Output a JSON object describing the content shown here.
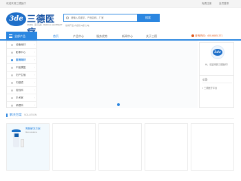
{
  "topbar": {
    "welcome": "欢迎来到三德医疗",
    "register": "免费注册",
    "login": "会员登录"
  },
  "logo": {
    "badge": "3de",
    "name": "三德医疗",
    "slogan": "SANDE · 医疗设备 · MEDICAL EQUIPMENT"
  },
  "search": {
    "placeholder": "请输入关键字，产品名称、厂家",
    "button": "搜索",
    "hot": "热销产品  内窥镜  B超  心电"
  },
  "nav": {
    "all_categories": "全部产品",
    "items": [
      "首页",
      "产品中心",
      "服务优势",
      "新闻中心",
      "关于三德"
    ],
    "hotline": "咨询热线：400-6665-371"
  },
  "categories": [
    {
      "label": "设备耗材"
    },
    {
      "label": "影像中心"
    },
    {
      "label": "医用耗材"
    },
    {
      "label": "中医康复"
    },
    {
      "label": "妇产生殖"
    },
    {
      "label": "内窥镜"
    },
    {
      "label": "检验科"
    },
    {
      "label": "手术室"
    },
    {
      "label": "病理科"
    }
  ],
  "userbox": {
    "avatar_text": "3de",
    "hello": "Hi，欢迎来到三德医疗！"
  },
  "news": {
    "title": "公告",
    "entry": "• 三德医疗平台"
  },
  "solution": {
    "title": "解决方案",
    "subtitle": "SOLUTION"
  },
  "cards": [
    {
      "title": "胃肠解决方案",
      "subtitle": "More solutions"
    },
    {
      "title": "",
      "subtitle": ""
    },
    {
      "title": "",
      "subtitle": ""
    },
    {
      "title": "",
      "subtitle": ""
    },
    {
      "title": "",
      "subtitle": ""
    }
  ],
  "colors": {
    "brand": "#2b86e0",
    "logo": "#1c56a6",
    "hotline": "#e05a1e"
  }
}
